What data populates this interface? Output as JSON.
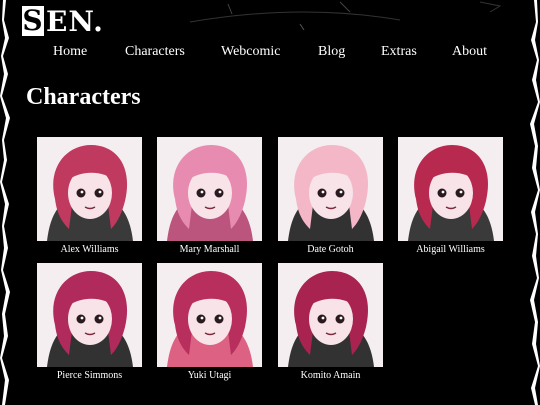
{
  "site": {
    "logo_text": "EN.",
    "logo_initial": "S"
  },
  "nav": {
    "items": [
      {
        "label": "Home"
      },
      {
        "label": "Characters"
      },
      {
        "label": "Webcomic"
      },
      {
        "label": "Blog"
      },
      {
        "label": "Extras"
      },
      {
        "label": "About"
      }
    ]
  },
  "main": {
    "title": "Characters",
    "characters": [
      {
        "name": "Alex Williams",
        "hair": "#c0395f",
        "accent": "#1a1a1a"
      },
      {
        "name": "Mary Marshall",
        "hair": "#e88bb0",
        "accent": "#b03a6a"
      },
      {
        "name": "Date Gotoh",
        "hair": "#f3b7c8",
        "accent": "#111111"
      },
      {
        "name": "Abigail Williams",
        "hair": "#b8294f",
        "accent": "#1a1a1a"
      },
      {
        "name": "Pierce Simmons",
        "hair": "#b02a5c",
        "accent": "#111111"
      },
      {
        "name": "Yuki Utagi",
        "hair": "#b82f5e",
        "accent": "#d8486e"
      },
      {
        "name": "Komito Amain",
        "hair": "#a8234f",
        "accent": "#111111"
      }
    ]
  }
}
